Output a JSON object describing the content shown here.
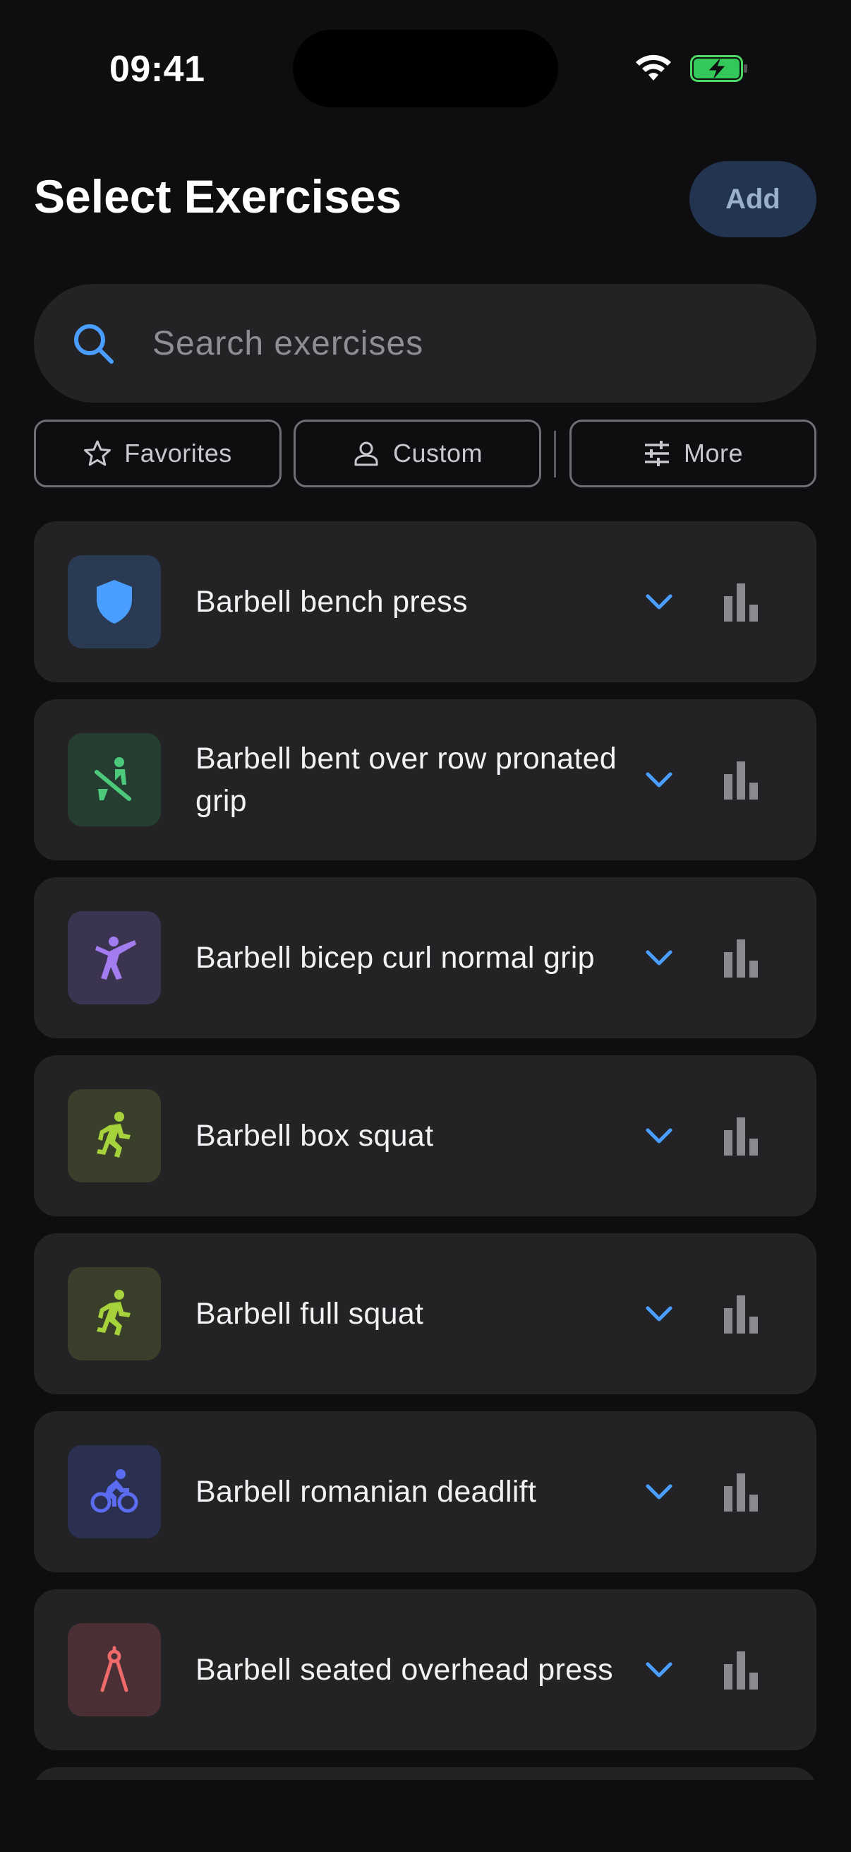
{
  "status_bar": {
    "time": "09:41"
  },
  "header": {
    "title": "Select Exercises",
    "add_label": "Add"
  },
  "search": {
    "placeholder": "Search exercises"
  },
  "filters": [
    {
      "label": "Favorites",
      "icon": "star-icon"
    },
    {
      "label": "Custom",
      "icon": "person-icon"
    },
    {
      "label": "More",
      "icon": "sliders-icon"
    }
  ],
  "colors": {
    "accent": "#4a9eff",
    "background": "#0e0e10",
    "card": "#232326"
  },
  "exercises": [
    {
      "name": "Barbell bench press",
      "icon": "shield-icon",
      "icon_bg": "#2a3a52",
      "icon_color": "#4a9eff"
    },
    {
      "name": "Barbell bent over row pronated grip",
      "icon": "rowing-icon",
      "icon_bg": "#263d31",
      "icon_color": "#4cc97a"
    },
    {
      "name": "Barbell bicep curl normal grip",
      "icon": "kick-icon",
      "icon_bg": "#3a3450",
      "icon_color": "#a47cf2"
    },
    {
      "name": "Barbell box squat",
      "icon": "running-icon",
      "icon_bg": "#393f2a",
      "icon_color": "#a6d23c"
    },
    {
      "name": "Barbell full squat",
      "icon": "running-icon",
      "icon_bg": "#393f2a",
      "icon_color": "#a6d23c"
    },
    {
      "name": "Barbell romanian deadlift",
      "icon": "cycling-icon",
      "icon_bg": "#2b3050",
      "icon_color": "#5b6cf0"
    },
    {
      "name": "Barbell seated overhead press",
      "icon": "compass-icon",
      "icon_bg": "#4a3034",
      "icon_color": "#ef6a6a"
    }
  ]
}
